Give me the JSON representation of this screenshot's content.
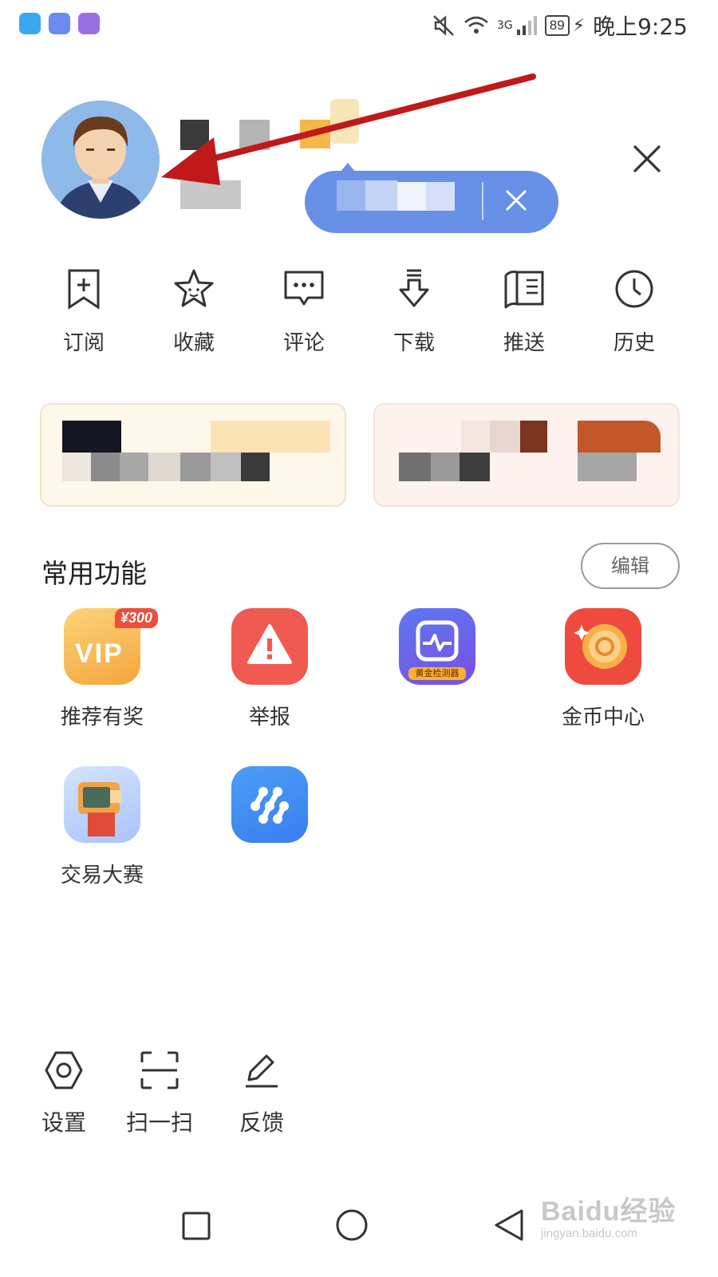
{
  "status_bar": {
    "signal_label": "3G",
    "battery": "89",
    "time": "晚上9:25",
    "app_icons": [
      {
        "name": "shield-app-icon",
        "color": "#3aa8f0"
      },
      {
        "name": "browser-app-icon",
        "color": "#6a8cf0"
      },
      {
        "name": "chart-app-icon",
        "color": "#9a6fe6"
      }
    ]
  },
  "profile": {
    "avatar_icon": "user-avatar",
    "close_icon": "close-icon"
  },
  "quick_actions": [
    {
      "label": "订阅",
      "icon": "bookmark-add-icon"
    },
    {
      "label": "收藏",
      "icon": "star-icon"
    },
    {
      "label": "评论",
      "icon": "comment-icon"
    },
    {
      "label": "下载",
      "icon": "download-icon"
    },
    {
      "label": "推送",
      "icon": "book-icon"
    },
    {
      "label": "历史",
      "icon": "clock-icon"
    }
  ],
  "section": {
    "title": "常用功能",
    "edit_label": "编辑"
  },
  "functions": [
    {
      "label": "推荐有奖",
      "icon": "vip-icon",
      "badge": "¥300",
      "icon_text": "VIP"
    },
    {
      "label": "举报",
      "icon": "warning-icon"
    },
    {
      "label": "",
      "icon": "gold-detector-icon",
      "badge": "黄金检测器"
    },
    {
      "label": "金币中心",
      "icon": "coin-icon"
    },
    {
      "label": "交易大赛",
      "icon": "trading-contest-icon"
    },
    {
      "label": "",
      "icon": "link-icon"
    }
  ],
  "tools": [
    {
      "label": "设置",
      "icon": "settings-icon"
    },
    {
      "label": "扫一扫",
      "icon": "scan-icon"
    },
    {
      "label": "反馈",
      "icon": "feedback-edit-icon"
    }
  ],
  "watermark": {
    "main": "Baidu经验",
    "sub": "jingyan.baidu.com"
  },
  "colors": {
    "arrow": "#c0191b",
    "pill": "#6790e6",
    "report": "#f05a50",
    "vip": "#f5b441",
    "coin": "#ee4b3e"
  }
}
